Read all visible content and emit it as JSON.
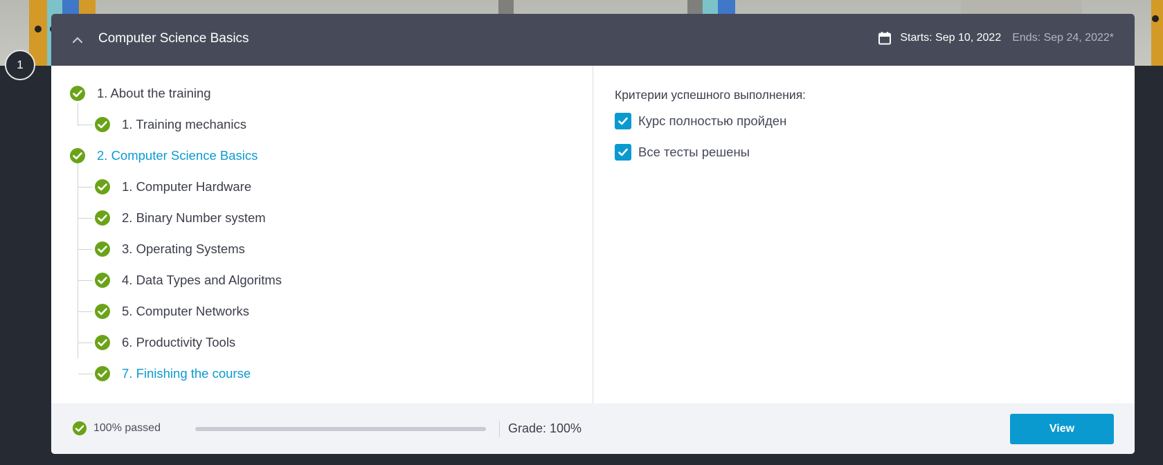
{
  "step_number": "1",
  "course": {
    "title": "Computer Science Basics",
    "starts": "Starts: Sep 10, 2022",
    "ends": "Ends: Sep 24, 2022*"
  },
  "tree": [
    {
      "label": "1. About the training",
      "level": 0,
      "active": false,
      "done": true
    },
    {
      "label": "1. Training mechanics",
      "level": 1,
      "active": false,
      "done": true
    },
    {
      "label": "2. Computer Science Basics",
      "level": 0,
      "active": true,
      "done": true
    },
    {
      "label": "1. Computer Hardware",
      "level": 1,
      "active": false,
      "done": true
    },
    {
      "label": "2. Binary Number system",
      "level": 1,
      "active": false,
      "done": true
    },
    {
      "label": "3. Operating Systems",
      "level": 1,
      "active": false,
      "done": true
    },
    {
      "label": "4. Data Types and Algoritms",
      "level": 1,
      "active": false,
      "done": true
    },
    {
      "label": "5. Computer Networks",
      "level": 1,
      "active": false,
      "done": true
    },
    {
      "label": "6. Productivity Tools",
      "level": 1,
      "active": false,
      "done": true
    },
    {
      "label": "7. Finishing the course",
      "level": 1,
      "active": true,
      "done": true
    }
  ],
  "criteria": {
    "title": "Критерии успешного выполнения:",
    "items": [
      {
        "label": "Курс полностью пройден",
        "checked": true
      },
      {
        "label": "Все тесты решены",
        "checked": true
      }
    ]
  },
  "footer": {
    "passed_label": "100% passed",
    "progress_fraction": 1.0,
    "grade": "Grade: 100%",
    "view_button": "View"
  },
  "colors": {
    "accent": "#0b9ad0",
    "success": "#6aa318",
    "header_bg": "#474b59",
    "page_bg": "#262a33"
  },
  "icons": {
    "collapse": "chevron-up-icon",
    "calendar": "calendar-icon",
    "check": "check-circle-icon",
    "checkbox": "checkbox-checked-icon"
  }
}
